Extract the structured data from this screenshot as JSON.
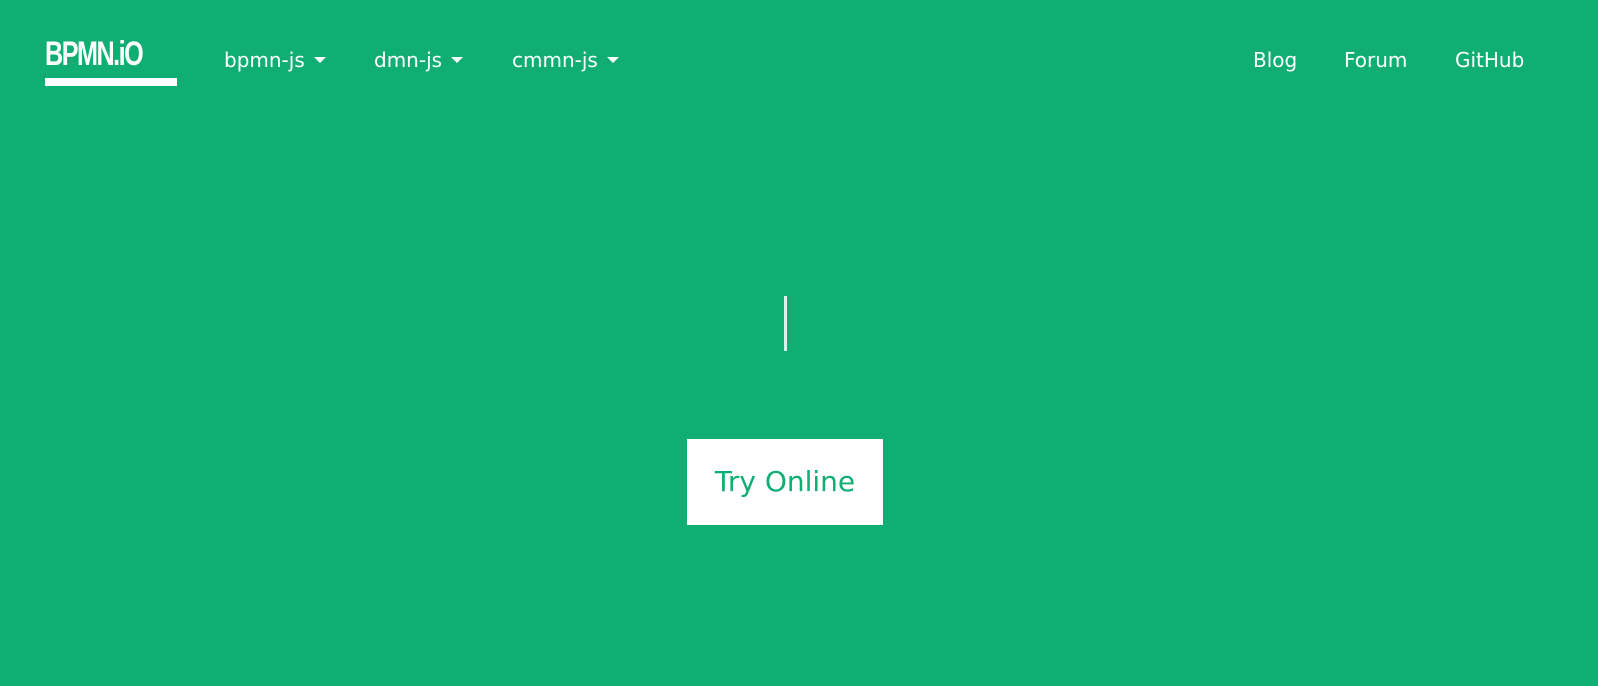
{
  "brand": {
    "logo_text": "BPMN.iO"
  },
  "nav": {
    "left_items": [
      {
        "label": "bpmn-js"
      },
      {
        "label": "dmn-js"
      },
      {
        "label": "cmmn-js"
      }
    ],
    "right_items": [
      {
        "label": "Blog"
      },
      {
        "label": "Forum"
      },
      {
        "label": "GitHub"
      }
    ]
  },
  "hero": {
    "cta_label": "Try Online"
  },
  "colors": {
    "background": "#10ae72",
    "text": "#ffffff",
    "button_background": "#ffffff",
    "button_text": "#10ae72"
  }
}
